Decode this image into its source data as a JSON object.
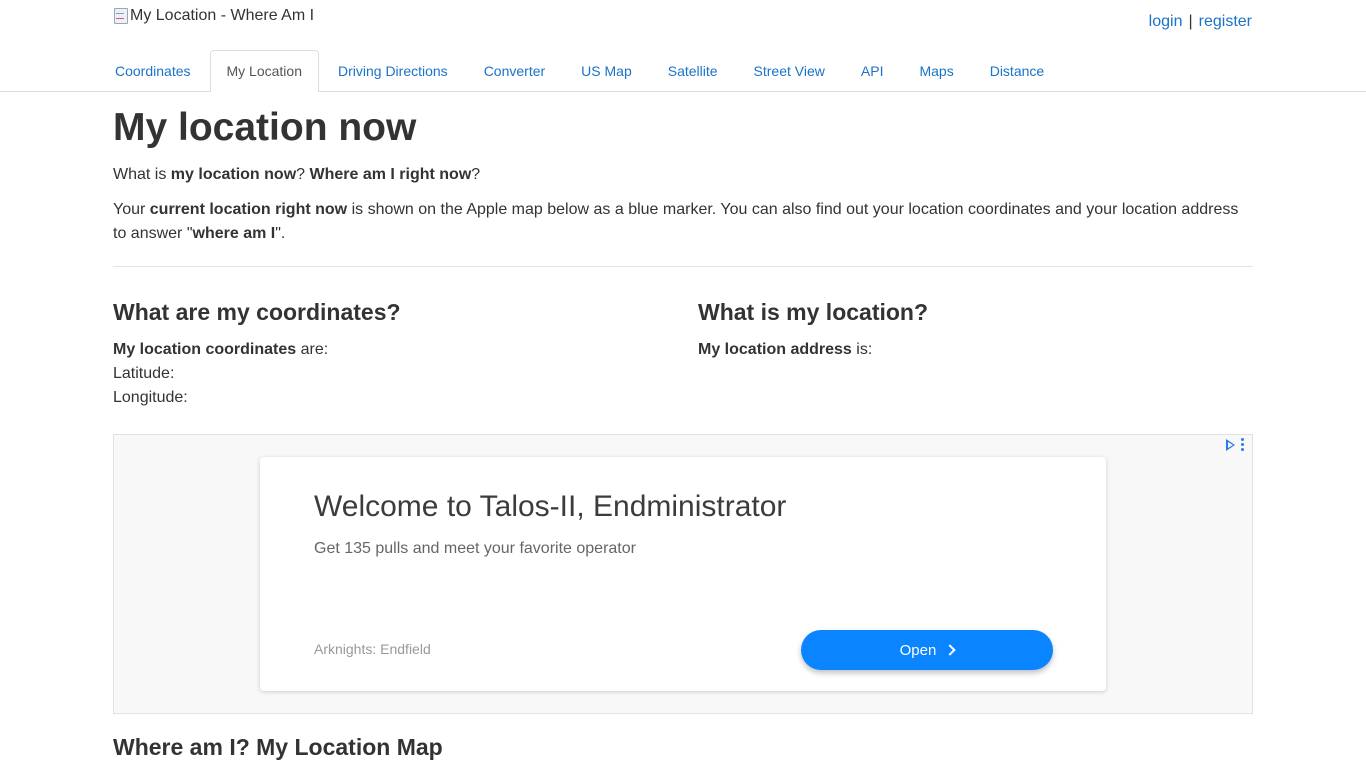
{
  "header": {
    "logo_alt": "My Location - Where Am I",
    "login_label": "login",
    "separator": "|",
    "register_label": "register"
  },
  "tabs": [
    {
      "label": "Coordinates",
      "active": false
    },
    {
      "label": "My Location",
      "active": true
    },
    {
      "label": "Driving Directions",
      "active": false
    },
    {
      "label": "Converter",
      "active": false
    },
    {
      "label": "US Map",
      "active": false
    },
    {
      "label": "Satellite",
      "active": false
    },
    {
      "label": "Street View",
      "active": false
    },
    {
      "label": "API",
      "active": false
    },
    {
      "label": "Maps",
      "active": false
    },
    {
      "label": "Distance",
      "active": false
    }
  ],
  "main": {
    "title": "My location now",
    "intro1": {
      "p1": "What is ",
      "b1": "my location now",
      "p2": "? ",
      "b2": "Where am I right now",
      "p3": "?"
    },
    "intro2": {
      "p1": "Your ",
      "b1": "current location right now",
      "p2": " is shown on the Apple map below as a blue marker. You can also find out your location coordinates and your location address to answer \"",
      "b2": "where am I",
      "p3": "\"."
    },
    "coords": {
      "heading": "What are my coordinates?",
      "label_bold": "My location coordinates",
      "label_rest": " are:",
      "latitude_label": "Latitude:",
      "latitude_value": "",
      "longitude_label": "Longitude:",
      "longitude_value": ""
    },
    "location": {
      "heading": "What is my location?",
      "label_bold": "My location address",
      "label_rest": " is:",
      "address_value": ""
    },
    "map_heading": "Where am I? My Location Map"
  },
  "ad": {
    "headline": "Welcome to Talos-II, Endministrator",
    "body": "Get 135 pulls and meet your favorite operator",
    "source": "Arknights: Endfield",
    "cta": "Open",
    "accent": "#0a84ff"
  },
  "colors": {
    "link": "#1a73c8",
    "text": "#333333"
  }
}
